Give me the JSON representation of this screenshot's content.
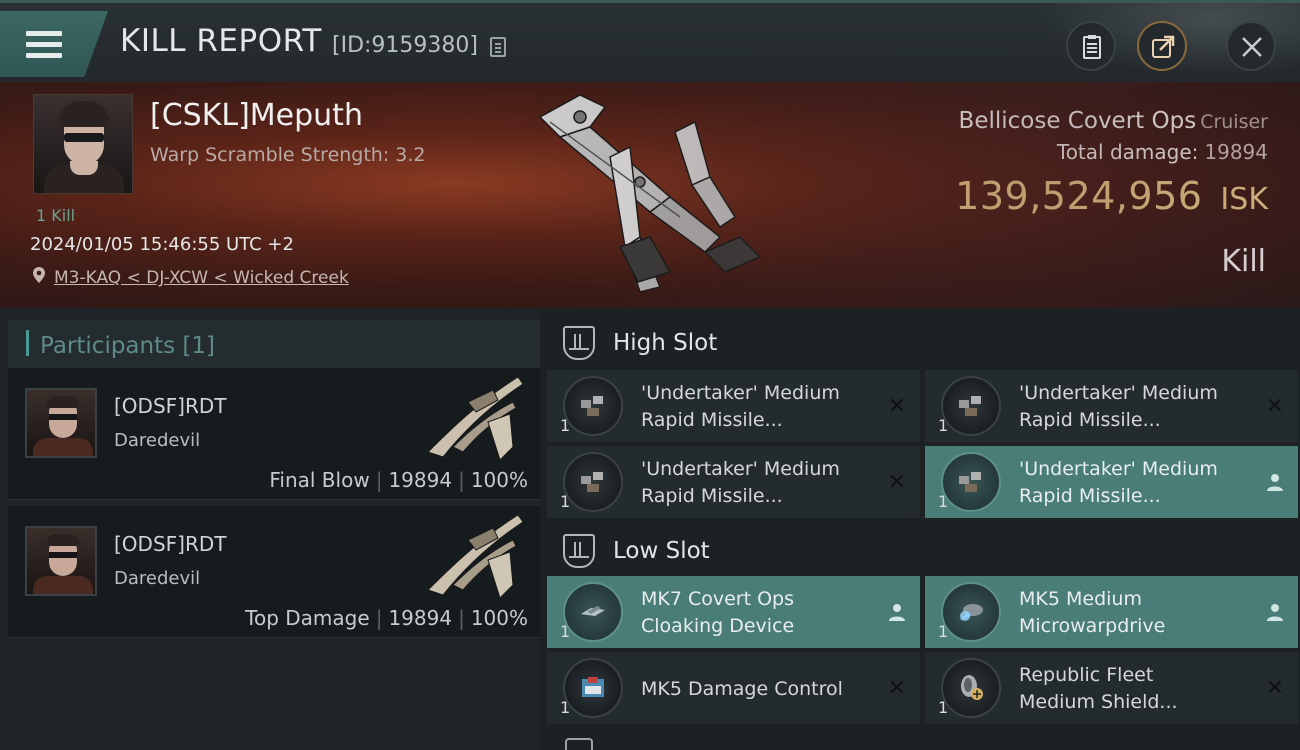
{
  "header": {
    "title": "KILL REPORT",
    "report_id": "[ID:9159380]"
  },
  "victim": {
    "name": "[CSKL]Meputh",
    "warp_scramble": "Warp Scramble Strength: 3.2",
    "kills": "1 Kill",
    "datetime": "2024/01/05 15:46:55 UTC +2",
    "location": "M3-KAQ < DJ-XCW < Wicked Creek",
    "ship_name": "Bellicose Covert Ops",
    "ship_class": "Cruiser",
    "total_damage_label": "Total damage:",
    "total_damage": "19894",
    "isk_value": "139,524,956",
    "isk_unit": "ISK",
    "result": "Kill"
  },
  "participants": {
    "title": "Participants [1]",
    "rows": [
      {
        "name": "[ODSF]RDT",
        "ship": "Daredevil",
        "role": "Final Blow",
        "damage": "19894",
        "percent": "100%"
      },
      {
        "name": "[ODSF]RDT",
        "ship": "Daredevil",
        "role": "Top Damage",
        "damage": "19894",
        "percent": "100%"
      }
    ]
  },
  "slots": {
    "high": {
      "title": "High Slot",
      "modules": [
        {
          "name_line1": "'Undertaker' Medium",
          "name_line2": "Rapid Missile...",
          "qty": "1",
          "status": "destroyed"
        },
        {
          "name_line1": "'Undertaker' Medium",
          "name_line2": "Rapid Missile...",
          "qty": "1",
          "status": "destroyed"
        },
        {
          "name_line1": "'Undertaker' Medium",
          "name_line2": "Rapid Missile...",
          "qty": "1",
          "status": "destroyed"
        },
        {
          "name_line1": "'Undertaker' Medium",
          "name_line2": "Rapid Missile...",
          "qty": "1",
          "status": "dropped"
        }
      ]
    },
    "low": {
      "title": "Low Slot",
      "modules": [
        {
          "name_line1": "MK7 Covert Ops",
          "name_line2": "Cloaking Device",
          "qty": "1",
          "status": "dropped"
        },
        {
          "name_line1": "MK5 Medium",
          "name_line2": "Microwarpdrive",
          "qty": "1",
          "status": "dropped"
        },
        {
          "name_line1": "MK5 Damage Control",
          "name_line2": "",
          "qty": "1",
          "status": "destroyed"
        },
        {
          "name_line1": "Republic Fleet",
          "name_line2": "Medium Shield...",
          "qty": "1",
          "status": "destroyed"
        }
      ]
    }
  },
  "icons": {
    "menu": "hamburger-icon",
    "copy": "copy-icon",
    "clipboard": "clipboard-icon",
    "share": "share-icon",
    "close": "close-icon",
    "location": "location-pin-icon",
    "destroyed": "x-icon",
    "dropped": "person-icon"
  },
  "colors": {
    "accent": "#4a7c78",
    "isk": "#e7c98a",
    "header_bg": "#262d30"
  }
}
